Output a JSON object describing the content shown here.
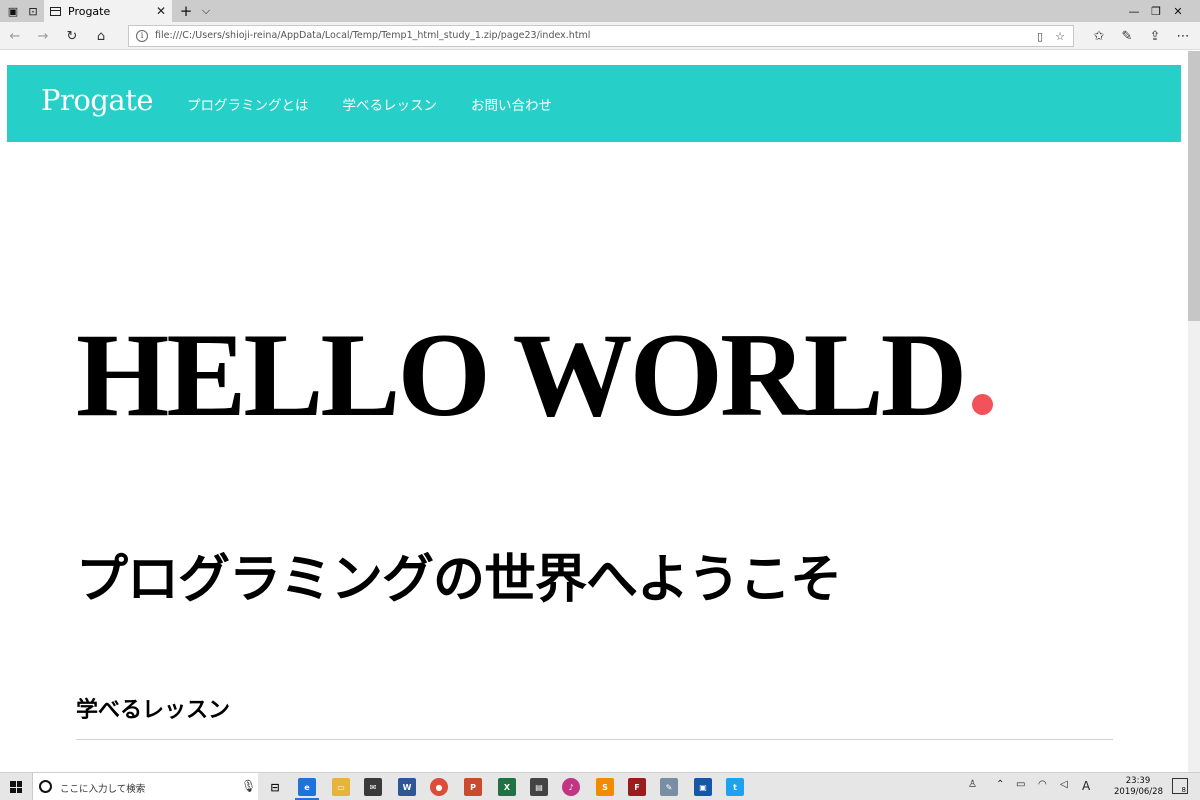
{
  "browser": {
    "tab_title": "Progate",
    "new_tab": "+",
    "tab_menu": "⌵",
    "url": "file:///C:/Users/shioji-reina/AppData/Local/Temp/Temp1_html_study_1.zip/page23/index.html"
  },
  "site": {
    "logo": "Progate",
    "menu": [
      "プログラミングとは",
      "学べるレッスン",
      "お問い合わせ"
    ],
    "hero": "HELLO WORLD",
    "subtitle": "プログラミングの世界へようこそ",
    "section_title": "学べるレッスン",
    "accent_color": "#f4525b",
    "header_color": "#26d0c9"
  },
  "taskbar": {
    "search_placeholder": "ここに入力して検索",
    "clock_time": "23:39",
    "clock_date": "2019/06/28",
    "ime_indicator": "A",
    "notification_count": "8"
  }
}
